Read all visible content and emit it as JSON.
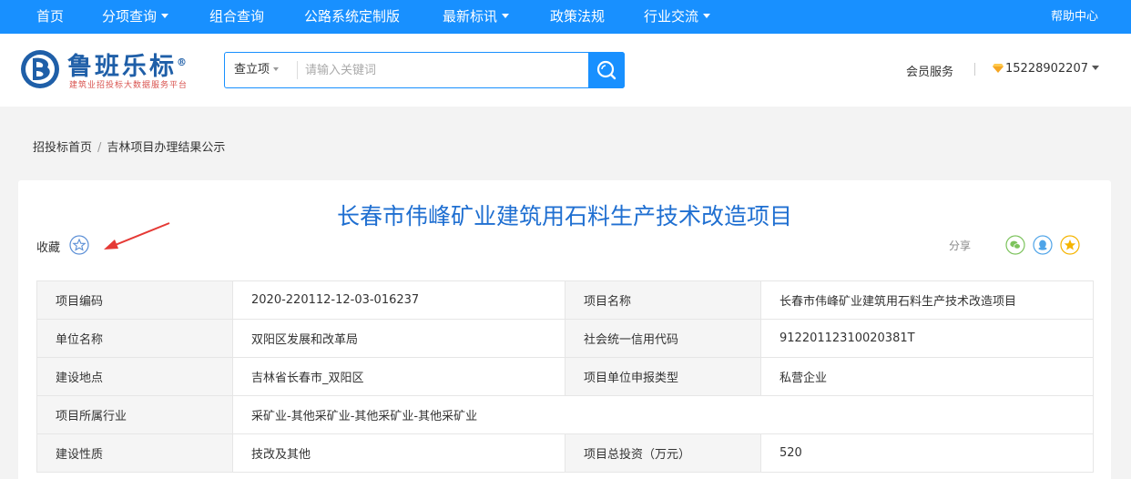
{
  "nav": {
    "items": [
      {
        "label": "首页",
        "has_dropdown": false
      },
      {
        "label": "分项查询",
        "has_dropdown": true
      },
      {
        "label": "组合查询",
        "has_dropdown": false
      },
      {
        "label": "公路系统定制版",
        "has_dropdown": false
      },
      {
        "label": "最新标讯",
        "has_dropdown": true
      },
      {
        "label": "政策法规",
        "has_dropdown": false
      },
      {
        "label": "行业交流",
        "has_dropdown": true
      }
    ],
    "help_label": "帮助中心",
    "bg_color": "#1890ff"
  },
  "header": {
    "logo_title": "鲁班乐标",
    "logo_registered": "®",
    "logo_subtitle": "建筑业招投标大数据服务平台",
    "search": {
      "select_label": "查立项",
      "placeholder": "请输入关键词",
      "value": ""
    },
    "member_label": "会员服务",
    "account_phone": "15228902207"
  },
  "breadcrumb": {
    "home": "招投标首页",
    "separator": "/",
    "current": "吉林项目办理结果公示"
  },
  "detail": {
    "title": "长春市伟峰矿业建筑用石料生产技术改造项目",
    "favorite_label": "收藏",
    "share_label": "分享",
    "share_icons": [
      "wechat-icon",
      "qq-icon",
      "qzone-icon"
    ],
    "rows": [
      {
        "l1": "项目编码",
        "v1": "2020-220112-12-03-016237",
        "l2": "项目名称",
        "v2": "长春市伟峰矿业建筑用石料生产技术改造项目"
      },
      {
        "l1": "单位名称",
        "v1": "双阳区发展和改革局",
        "l2": "社会统一信用代码",
        "v2": "91220112310020381T"
      },
      {
        "l1": "建设地点",
        "v1": "吉林省长春市_双阳区",
        "l2": "项目单位申报类型",
        "v2": "私营企业"
      },
      {
        "l1": "项目所属行业",
        "v1": "采矿业-其他采矿业-其他采矿业-其他采矿业"
      },
      {
        "l1": "建设性质",
        "v1": "技改及其他",
        "l2": "项目总投资（万元）",
        "v2": "520"
      }
    ]
  }
}
